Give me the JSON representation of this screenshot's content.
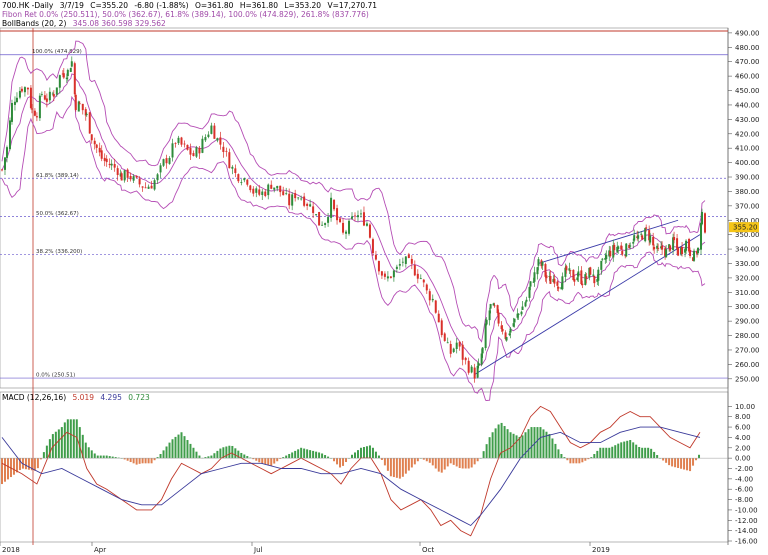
{
  "header": {
    "symbol": "700.HK -Daily",
    "date": "3/7/19",
    "close": "C=355.20",
    "change": "-6.80 (-1.88%)",
    "open": "O=361.80",
    "high": "H=361.80",
    "low": "L=353.20",
    "volume": "V=17,270.71",
    "fibo": "Fibon Ret 0.0% (250.511), 50.0% (362.67), 61.8% (389.14), 100.0% (474.829), 261.8% (837.776)",
    "bbands": "BollBands (20, 2)",
    "bbands_values": "345.08 360.598 329.562"
  },
  "macd_header": {
    "label": "MACD (12,26,16)",
    "v1": "5.019",
    "v2": "4.295",
    "v3": "0.723"
  },
  "price_axis": {
    "min": 245,
    "max": 492,
    "ticks": [
      "250.00",
      "260.00",
      "270.00",
      "280.00",
      "290.00",
      "300.00",
      "310.00",
      "320.00",
      "330.00",
      "340.00",
      "350.00",
      "360.00",
      "370.00",
      "380.00",
      "390.00",
      "400.00",
      "410.00",
      "420.00",
      "430.00",
      "440.00",
      "450.00",
      "460.00",
      "470.00",
      "480.00",
      "490.00"
    ],
    "last_price": "355.20"
  },
  "macd_axis": {
    "min": -16,
    "max": 12,
    "ticks": [
      "10.00",
      "8.00",
      "6.00",
      "4.00",
      "2.00",
      "0.00",
      "-2.00",
      "-4.00",
      "-6.00",
      "-8.00",
      "-10.00",
      "-12.00",
      "-14.00",
      "-16.00"
    ]
  },
  "time_axis": [
    "2018",
    "Apr",
    "Jul",
    "Oct",
    "2019"
  ],
  "fib_labels": [
    "100.0% (474.829)",
    "61.8% (389.14)",
    "50.0% (362.67)",
    "38.2% (336.200)",
    "0.0% (250.51)"
  ],
  "colors": {
    "up": "#2e8b3a",
    "down": "#d9302a",
    "bollinger": "#b54db5",
    "fib": "#6a5acd",
    "macd_line": "#c0392b",
    "signal_line": "#3a3a9a",
    "hist_pos": "#3f9d4a",
    "hist_neg": "#e08050",
    "cursor": "#c0392b"
  },
  "chart_data": [
    {
      "type": "candlestick",
      "title": "700.HK -Daily",
      "x": [
        "2018",
        "Apr",
        "Jul",
        "Oct",
        "2019"
      ],
      "ylim": [
        245,
        492
      ],
      "grid": false,
      "close_path": [
        [
          0,
          395
        ],
        [
          5,
          410
        ],
        [
          10,
          440
        ],
        [
          15,
          448
        ],
        [
          20,
          452
        ],
        [
          26,
          452
        ],
        [
          30,
          436
        ],
        [
          35,
          435
        ],
        [
          40,
          448
        ],
        [
          45,
          444
        ],
        [
          52,
          448
        ],
        [
          58,
          460
        ],
        [
          62,
          462
        ],
        [
          66,
          463
        ],
        [
          70,
          470
        ],
        [
          74,
          440
        ],
        [
          78,
          440
        ],
        [
          85,
          432
        ],
        [
          90,
          418
        ],
        [
          95,
          410
        ],
        [
          100,
          403
        ],
        [
          105,
          400
        ],
        [
          110,
          398
        ],
        [
          116,
          395
        ],
        [
          120,
          390
        ],
        [
          126,
          392
        ],
        [
          132,
          388
        ],
        [
          138,
          385
        ],
        [
          144,
          383
        ],
        [
          150,
          385
        ],
        [
          156,
          390
        ],
        [
          162,
          400
        ],
        [
          168,
          405
        ],
        [
          174,
          415
        ],
        [
          180,
          412
        ],
        [
          186,
          408
        ],
        [
          192,
          405
        ],
        [
          198,
          410
        ],
        [
          204,
          418
        ],
        [
          210,
          425
        ],
        [
          216,
          416
        ],
        [
          222,
          410
        ],
        [
          228,
          400
        ],
        [
          234,
          392
        ],
        [
          240,
          390
        ],
        [
          246,
          388
        ],
        [
          252,
          380
        ],
        [
          258,
          378
        ],
        [
          264,
          380
        ],
        [
          270,
          385
        ],
        [
          276,
          382
        ],
        [
          282,
          378
        ],
        [
          288,
          372
        ],
        [
          294,
          378
        ],
        [
          300,
          376
        ],
        [
          306,
          372
        ],
        [
          312,
          368
        ],
        [
          318,
          358
        ],
        [
          324,
          360
        ],
        [
          330,
          372
        ],
        [
          336,
          360
        ],
        [
          342,
          350
        ],
        [
          348,
          356
        ],
        [
          354,
          364
        ],
        [
          360,
          362
        ],
        [
          366,
          358
        ],
        [
          372,
          340
        ],
        [
          378,
          328
        ],
        [
          384,
          318
        ],
        [
          390,
          322
        ],
        [
          396,
          326
        ],
        [
          402,
          332
        ],
        [
          408,
          330
        ],
        [
          414,
          325
        ],
        [
          420,
          320
        ],
        [
          426,
          310
        ],
        [
          432,
          305
        ],
        [
          438,
          290
        ],
        [
          444,
          275
        ],
        [
          450,
          268
        ],
        [
          456,
          275
        ],
        [
          462,
          265
        ],
        [
          468,
          258
        ],
        [
          474,
          253
        ],
        [
          478,
          258
        ],
        [
          482,
          270
        ],
        [
          486,
          290
        ],
        [
          490,
          300
        ],
        [
          494,
          298
        ],
        [
          498,
          290
        ],
        [
          502,
          285
        ],
        [
          506,
          278
        ],
        [
          510,
          285
        ],
        [
          514,
          290
        ],
        [
          518,
          295
        ],
        [
          522,
          300
        ],
        [
          526,
          305
        ],
        [
          530,
          315
        ],
        [
          534,
          322
        ],
        [
          538,
          330
        ],
        [
          542,
          328
        ],
        [
          546,
          320
        ],
        [
          550,
          318
        ],
        [
          554,
          320
        ],
        [
          558,
          316
        ],
        [
          562,
          318
        ],
        [
          566,
          325
        ],
        [
          570,
          322
        ],
        [
          574,
          320
        ],
        [
          578,
          322
        ],
        [
          582,
          318
        ],
        [
          586,
          320
        ],
        [
          590,
          325
        ],
        [
          594,
          318
        ],
        [
          598,
          322
        ],
        [
          602,
          330
        ],
        [
          606,
          335
        ],
        [
          610,
          338
        ],
        [
          614,
          340
        ],
        [
          618,
          342
        ],
        [
          622,
          338
        ],
        [
          626,
          340
        ],
        [
          630,
          345
        ],
        [
          634,
          348
        ],
        [
          638,
          346
        ],
        [
          642,
          350
        ],
        [
          646,
          352
        ],
        [
          650,
          348
        ],
        [
          654,
          340
        ],
        [
          658,
          338
        ],
        [
          662,
          340
        ],
        [
          666,
          338
        ],
        [
          670,
          342
        ],
        [
          674,
          345
        ],
        [
          678,
          338
        ],
        [
          682,
          340
        ],
        [
          686,
          345
        ],
        [
          690,
          338
        ],
        [
          694,
          335
        ],
        [
          698,
          340
        ],
        [
          702,
          362
        ],
        [
          705,
          355
        ]
      ]
    },
    {
      "type": "line",
      "title": "MACD (12,26,16)",
      "ylim": [
        -16,
        12
      ],
      "series": [
        {
          "name": "MACD",
          "values": [
            [
              0,
              -1
            ],
            [
              20,
              -3
            ],
            [
              35,
              -5
            ],
            [
              50,
              2
            ],
            [
              65,
              5
            ],
            [
              75,
              4
            ],
            [
              85,
              -2
            ],
            [
              95,
              -5
            ],
            [
              105,
              -6
            ],
            [
              120,
              -8
            ],
            [
              135,
              -10
            ],
            [
              150,
              -10
            ],
            [
              160,
              -8
            ],
            [
              170,
              -4
            ],
            [
              180,
              -1
            ],
            [
              190,
              -2
            ],
            [
              200,
              -3
            ],
            [
              210,
              -2
            ],
            [
              220,
              0
            ],
            [
              230,
              1
            ],
            [
              240,
              0
            ],
            [
              250,
              -1
            ],
            [
              260,
              -2
            ],
            [
              270,
              -3
            ],
            [
              280,
              -2
            ],
            [
              290,
              -1
            ],
            [
              300,
              0
            ],
            [
              310,
              -1
            ],
            [
              320,
              -2
            ],
            [
              330,
              -3
            ],
            [
              340,
              -5
            ],
            [
              350,
              -2
            ],
            [
              360,
              0
            ],
            [
              370,
              0
            ],
            [
              380,
              -3
            ],
            [
              390,
              -8
            ],
            [
              400,
              -10
            ],
            [
              410,
              -9
            ],
            [
              420,
              -8
            ],
            [
              430,
              -10
            ],
            [
              440,
              -13
            ],
            [
              450,
              -12
            ],
            [
              460,
              -14
            ],
            [
              470,
              -15
            ],
            [
              480,
              -11
            ],
            [
              490,
              -4
            ],
            [
              500,
              1
            ],
            [
              510,
              2
            ],
            [
              520,
              4
            ],
            [
              530,
              8
            ],
            [
              540,
              10
            ],
            [
              550,
              9
            ],
            [
              560,
              6
            ],
            [
              570,
              3
            ],
            [
              580,
              2
            ],
            [
              590,
              3
            ],
            [
              600,
              5
            ],
            [
              610,
              6
            ],
            [
              620,
              8
            ],
            [
              630,
              9
            ],
            [
              640,
              8
            ],
            [
              650,
              8
            ],
            [
              660,
              6
            ],
            [
              670,
              4
            ],
            [
              680,
              3
            ],
            [
              690,
              2
            ],
            [
              700,
              5
            ]
          ]
        },
        {
          "name": "Signal",
          "values": [
            [
              0,
              4
            ],
            [
              20,
              -1
            ],
            [
              40,
              -3
            ],
            [
              60,
              -2
            ],
            [
              80,
              -4
            ],
            [
              100,
              -6
            ],
            [
              120,
              -8
            ],
            [
              140,
              -9
            ],
            [
              160,
              -9
            ],
            [
              180,
              -6
            ],
            [
              200,
              -3
            ],
            [
              220,
              -2
            ],
            [
              240,
              -1
            ],
            [
              260,
              -1
            ],
            [
              280,
              -2
            ],
            [
              300,
              -2
            ],
            [
              320,
              -3
            ],
            [
              340,
              -3
            ],
            [
              360,
              -2
            ],
            [
              380,
              -3
            ],
            [
              400,
              -6
            ],
            [
              420,
              -8
            ],
            [
              440,
              -10
            ],
            [
              460,
              -12
            ],
            [
              470,
              -13
            ],
            [
              480,
              -11
            ],
            [
              500,
              -6
            ],
            [
              520,
              0
            ],
            [
              540,
              4
            ],
            [
              560,
              5
            ],
            [
              580,
              3
            ],
            [
              600,
              3
            ],
            [
              620,
              5
            ],
            [
              640,
              6
            ],
            [
              660,
              6
            ],
            [
              680,
              5
            ],
            [
              700,
              4
            ]
          ]
        }
      ]
    }
  ]
}
